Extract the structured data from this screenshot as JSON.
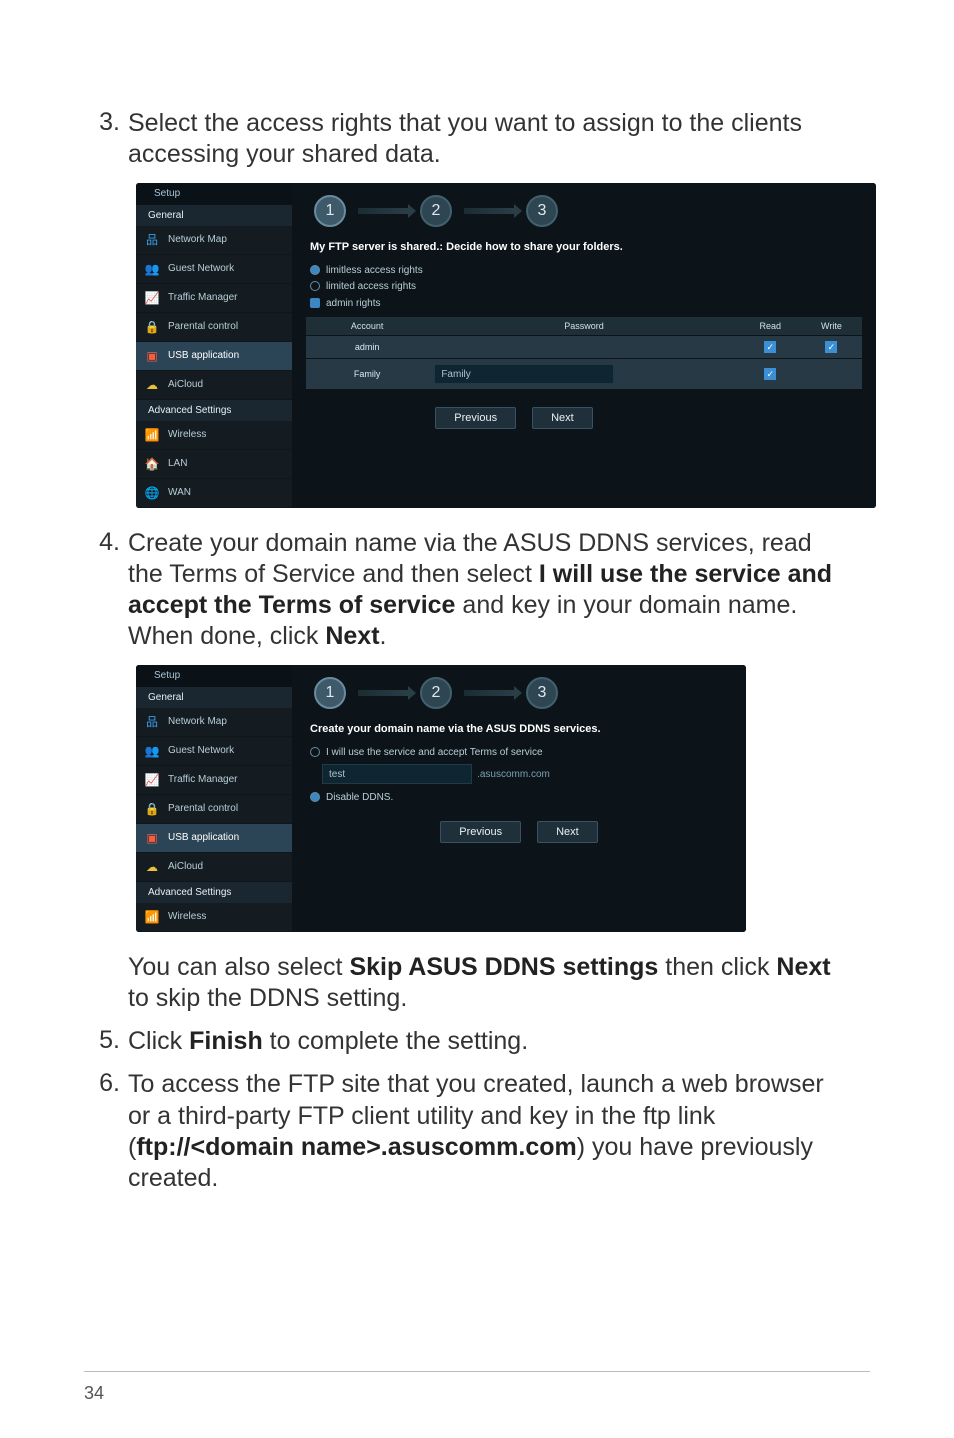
{
  "step3": {
    "num": "3.",
    "text_a": "Select the access rights that you want to assign to the clients ",
    "text_b": "accessing your shared data."
  },
  "step4": {
    "num": "4.",
    "p1a": "Create your domain name via the ASUS DDNS services, read ",
    "p1b": "the Terms of Service and then select ",
    "p1c": "I will use the service and ",
    "p2a": "accept the Terms of service",
    "p2b": " and key in your domain name. ",
    "p3a": "When done, click ",
    "p3b": "Next",
    "p3c": "."
  },
  "skip": {
    "a": "You can also select ",
    "b": "Skip ASUS DDNS settings",
    "c": " then click ",
    "d": "Next",
    "e": " to skip the DDNS setting."
  },
  "step5": {
    "num": "5.",
    "a": "Click ",
    "b": "Finish",
    "c": " to complete the setting."
  },
  "step6": {
    "num": "6.",
    "a": "To access the FTP site that you created, launch a web browser ",
    "b": "or a third-party FTP client utility and key in the ftp link ",
    "c": "(",
    "d": "ftp://<domain name>.asuscomm.com",
    "e": ") you have previously ",
    "f": "created."
  },
  "page_number": "34",
  "shot1": {
    "toolbar": "Setup",
    "section_general": "General",
    "nav": {
      "netmap": "Network Map",
      "guest": "Guest Network",
      "traffic": "Traffic Manager",
      "parental": "Parental control",
      "usb": "USB application",
      "aicloud": "AiCloud"
    },
    "section_advanced": "Advanced Settings",
    "nav2": {
      "wireless": "Wireless",
      "lan": "LAN",
      "wan": "WAN"
    },
    "stepper": {
      "s1": "1",
      "s2": "2",
      "s3": "3"
    },
    "panehead": "My FTP server is shared.: Decide how to share your folders.",
    "r1": "limitless access rights",
    "r2": "limited access rights",
    "adminrights": "admin rights",
    "table": {
      "h_account": "Account",
      "h_password": "Password",
      "h_read": "Read",
      "h_write": "Write",
      "r1_account": "admin",
      "r1_password": "",
      "r2_account": "Family",
      "r2_password": "Family"
    },
    "btn_prev": "Previous",
    "btn_next": "Next"
  },
  "shot2": {
    "toolbar": "Setup",
    "section_general": "General",
    "nav": {
      "netmap": "Network Map",
      "guest": "Guest Network",
      "traffic": "Traffic Manager",
      "parental": "Parental control",
      "usb": "USB application",
      "aicloud": "AiCloud"
    },
    "section_advanced": "Advanced Settings",
    "nav2": {
      "wireless": "Wireless"
    },
    "stepper": {
      "s1": "1",
      "s2": "2",
      "s3": "3"
    },
    "panehead": "Create your domain name via the ASUS DDNS services.",
    "r1": "I will use the service and accept Terms of service",
    "field_value": "test",
    "field_suffix": ".asuscomm.com",
    "r2": "Disable DDNS.",
    "btn_prev": "Previous",
    "btn_next": "Next"
  }
}
